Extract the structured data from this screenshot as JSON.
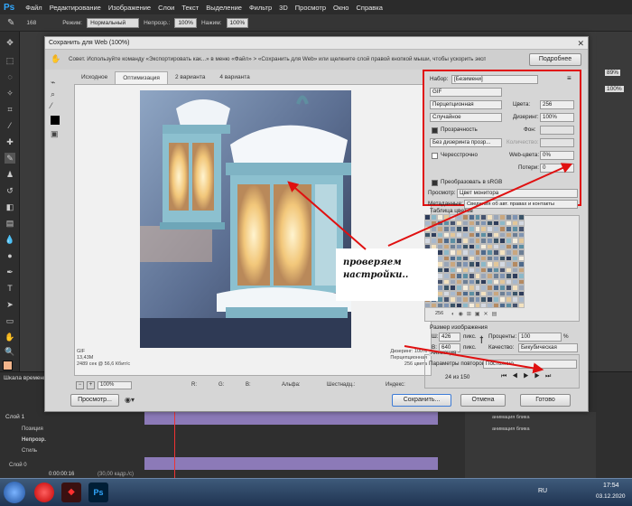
{
  "app": {
    "logo": "Ps",
    "menu": [
      "Файл",
      "Редактирование",
      "Изображение",
      "Слои",
      "Текст",
      "Выделение",
      "Фильтр",
      "3D",
      "Просмотр",
      "Окно",
      "Справка"
    ],
    "options": {
      "brush_size": "168",
      "mode_label": "Режим:",
      "mode_value": "Нормальный",
      "opacity_label": "Непрозр.:",
      "opacity_value": "100%",
      "flow_label": "Нажим:",
      "flow_value": "100%"
    }
  },
  "dialog": {
    "title": "Сохранить для Web (100%)",
    "tip": "Совет. Используйте команду «Экспортировать как...» в меню «Файл» > «Сохранить для Web» или щелкните слой правой кнопкой мыши, чтобы ускорить экспорт ресурсов",
    "more_button": "Подробнее",
    "tabs": [
      "Исходное",
      "Оптимизация",
      "2 варианта",
      "4 варианта"
    ],
    "active_tab": "Оптимизация",
    "preview_info_left": [
      "GIF",
      "13,43M",
      "2489 сек @ 56,6 Кбит/с"
    ],
    "preview_info_right": [
      "Дизеринг: 100%",
      "Перцепционная",
      "256 цвета"
    ],
    "zoom": "100%",
    "pixel_readout": [
      "R:",
      "G:",
      "B:",
      "Альфа:",
      "Шестнадц.:",
      "Индекс:"
    ],
    "preview_button": "Просмотр...",
    "save_button": "Сохранить...",
    "cancel_button": "Отмена",
    "done_button": "Готово"
  },
  "settings": {
    "preset_label": "Набор:",
    "preset_value": "[Безимени]",
    "format": "GIF",
    "reduction": "Перцепционная",
    "colors_label": "Цвета:",
    "colors_value": "256",
    "dither_algo": "Случайное",
    "dither_label": "Дизеринг:",
    "dither_value": "100%",
    "transparency_label": "Прозрачность",
    "matte_label": "Фон:",
    "transp_dither": "Без дизеринга прозр...",
    "amount_label": "Количество:",
    "interlaced_label": "Чересстрочно",
    "webcolors_label": "Web-цвета:",
    "webcolors_value": "0%",
    "lossy_label": "Потери:",
    "lossy_value": "0",
    "srgb_label": "Преобразовать в sRGB",
    "preview_label": "Просмотр:",
    "preview_value": "Цвет монитора",
    "metadata_label": "Метаданные:",
    "metadata_value": "Сведения об авт. правах и контакты"
  },
  "color_table": {
    "title": "Таблица цветов",
    "count": "256"
  },
  "image_size": {
    "title": "Размер изображения",
    "w_label": "Ш:",
    "w_value": "426",
    "h_label": "В:",
    "h_value": "640",
    "unit": "пикс.",
    "percent_label": "Проценты:",
    "percent_value": "100",
    "pct_unit": "%",
    "quality_label": "Качество:",
    "quality_value": "Бикубическая"
  },
  "animation": {
    "title": "Анимация",
    "loop_label": "Параметры повторов:",
    "loop_value": "Постоянно",
    "frame_counter": "24 из 150"
  },
  "annotation": {
    "line1": "проверяем",
    "line2": "настройки.."
  },
  "right_panel": {
    "zoom1": "89%",
    "zoom2": "100%",
    "layer1": "анимация блика",
    "layer2": "анимация блика"
  },
  "timeline": {
    "title": "Шкала времени",
    "layer_row": "Слой 1",
    "props": [
      "Позиция",
      "Непрозр.",
      "Стиль"
    ],
    "layer0": "Слой 0",
    "time": "0:00:00:16",
    "fps": "(30,00 кадр./с)"
  },
  "taskbar": {
    "lang": "RU",
    "time": "17:54",
    "date": "03.12.2020"
  },
  "colors": {
    "red_annotation": "#e01010",
    "ps_blue": "#31a8ff",
    "purple_track": "#8c7ab8"
  }
}
